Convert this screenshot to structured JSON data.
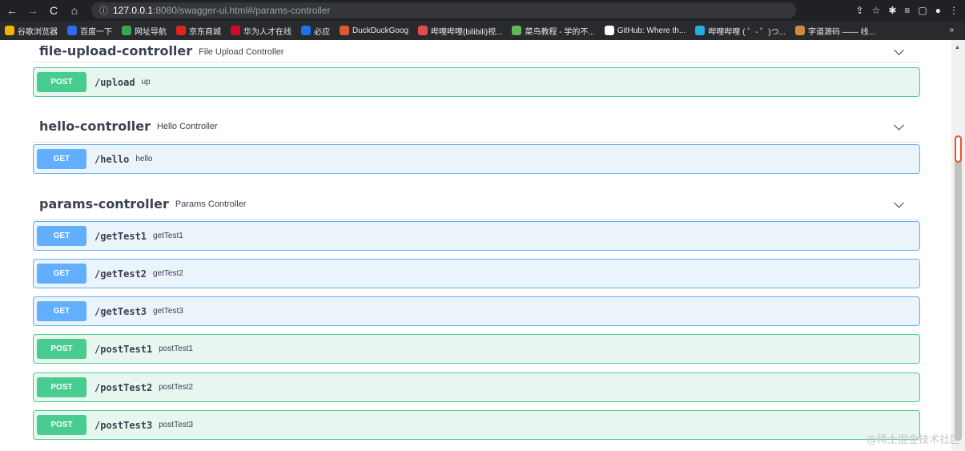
{
  "browser": {
    "url_host": "127.0.0.1",
    "url_rest": ":8080/swagger-ui.html#/params-controller",
    "bookmarks": [
      {
        "label": "谷歌浏览器",
        "color": "#f4b400",
        "icon": "chrome-icon"
      },
      {
        "label": "百度一下",
        "color": "#2f6bf5",
        "icon": "baidu-icon"
      },
      {
        "label": "网址导航",
        "color": "#34a853",
        "icon": "home-icon"
      },
      {
        "label": "京东商城",
        "color": "#e1251b",
        "icon": "jd-icon"
      },
      {
        "label": "华为人才在线",
        "color": "#cf0a2c",
        "icon": "huawei-icon"
      },
      {
        "label": "必应",
        "color": "#1a73e8",
        "icon": "search-icon"
      },
      {
        "label": "DuckDuckGoog",
        "color": "#de5833",
        "icon": "duck-icon"
      },
      {
        "label": "哔哩哔哩(bilibili)视...",
        "color": "#e14b4b",
        "icon": "bilibili-icon"
      },
      {
        "label": "菜鸟教程 - 学的不...",
        "color": "#5fb85c",
        "icon": "runoob-icon"
      },
      {
        "label": "GitHub: Where th...",
        "color": "#ffffff",
        "icon": "github-icon"
      },
      {
        "label": "哔哩哔哩 ( ゜- ゜)つ...",
        "color": "#23ade5",
        "icon": "bilibili-tv-icon"
      },
      {
        "label": "字道源码 —— 线...",
        "color": "#d08a3a",
        "icon": "avatar-icon"
      }
    ],
    "bookmarks_more": "»"
  },
  "sections": [
    {
      "name": "file-upload-controller",
      "description": "File Upload Controller",
      "operations": [
        {
          "method": "POST",
          "path": "/upload",
          "summary": "up"
        }
      ]
    },
    {
      "name": "hello-controller",
      "description": "Hello Controller",
      "operations": [
        {
          "method": "GET",
          "path": "/hello",
          "summary": "hello"
        }
      ]
    },
    {
      "name": "params-controller",
      "description": "Params Controller",
      "operations": [
        {
          "method": "GET",
          "path": "/getTest1",
          "summary": "getTest1"
        },
        {
          "method": "GET",
          "path": "/getTest2",
          "summary": "getTest2"
        },
        {
          "method": "GET",
          "path": "/getTest3",
          "summary": "getTest3"
        },
        {
          "method": "POST",
          "path": "/postTest1",
          "summary": "postTest1"
        },
        {
          "method": "POST",
          "path": "/postTest2",
          "summary": "postTest2"
        },
        {
          "method": "POST",
          "path": "/postTest3",
          "summary": "postTest3"
        }
      ]
    }
  ],
  "watermark": "@稀土掘金技术社区",
  "colors": {
    "get": "#61affe",
    "post": "#49cc90",
    "text": "#3b4151"
  }
}
